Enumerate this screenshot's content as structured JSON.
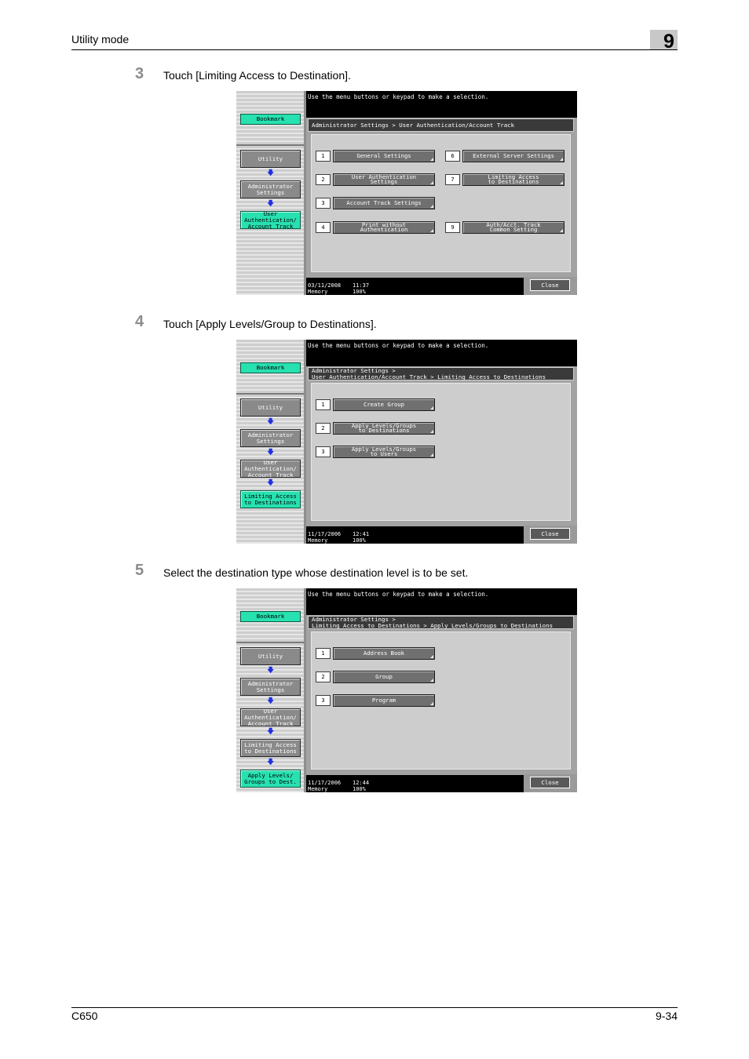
{
  "header": {
    "title": "Utility mode",
    "chapter": "9"
  },
  "footer": {
    "model": "C650",
    "page": "9-34"
  },
  "steps": [
    {
      "number": "3",
      "text": "Touch [Limiting Access to Destination].",
      "screen": {
        "message": "Use the menu buttons or keypad to make a selection.",
        "bookmark": "Bookmark",
        "breadcrumb": "Administrator Settings > User Authentication/Account Track",
        "sidebar": [
          "Utility",
          "Administrator\nSettings",
          "User\nAuthentication/\nAccount Track"
        ],
        "menu": [
          {
            "num": "1",
            "label": "General Settings"
          },
          {
            "num": "2",
            "label": "User Authentication\nSettings"
          },
          {
            "num": "3",
            "label": "Account Track Settings"
          },
          {
            "num": "4",
            "label": "Print without\nAuthentication"
          },
          {
            "num": "6",
            "label": "External Server Settings"
          },
          {
            "num": "7",
            "label": "Limiting Access\nto Destinations"
          },
          {
            "num": "9",
            "label": "Auth/Acct. Track\nCommon Setting"
          }
        ],
        "date": "03/11/2008",
        "time": "11:37",
        "memory_label": "Memory",
        "memory": "100%",
        "close": "Close"
      }
    },
    {
      "number": "4",
      "text": "Touch [Apply Levels/Group to Destinations].",
      "screen": {
        "message": "Use the menu buttons or keypad to make a selection.",
        "bookmark": "Bookmark",
        "breadcrumb": "Administrator Settings >\nUser Authentication/Account Track > Limiting Access to Destinations",
        "sidebar": [
          "Utility",
          "Administrator\nSettings",
          "User\nAuthentication/\nAccount Track",
          "Limiting Access\nto Destinations"
        ],
        "menu": [
          {
            "num": "1",
            "label": "Create Group"
          },
          {
            "num": "2",
            "label": "Apply Levels/Groups\nto Destinations"
          },
          {
            "num": "3",
            "label": "Apply Levels/Groups\nto Users"
          }
        ],
        "date": "11/17/2006",
        "time": "12:41",
        "memory_label": "Memory",
        "memory": "100%",
        "close": "Close"
      }
    },
    {
      "number": "5",
      "text": "Select the destination type whose destination level is to be set.",
      "screen": {
        "message": "Use the menu buttons or keypad to make a selection.",
        "bookmark": "Bookmark",
        "breadcrumb": "Administrator Settings >\nLimiting Access to Destinations > Apply Levels/Groups to Destinations",
        "sidebar": [
          "Utility",
          "Administrator\nSettings",
          "User\nAuthentication/\nAccount Track",
          "Limiting Access\nto Destinations",
          "Apply Levels/\nGroups to Dest."
        ],
        "menu": [
          {
            "num": "1",
            "label": "Address Book"
          },
          {
            "num": "2",
            "label": "Group"
          },
          {
            "num": "3",
            "label": "Program"
          }
        ],
        "date": "11/17/2006",
        "time": "12:44",
        "memory_label": "Memory",
        "memory": "100%",
        "close": "Close"
      }
    }
  ]
}
